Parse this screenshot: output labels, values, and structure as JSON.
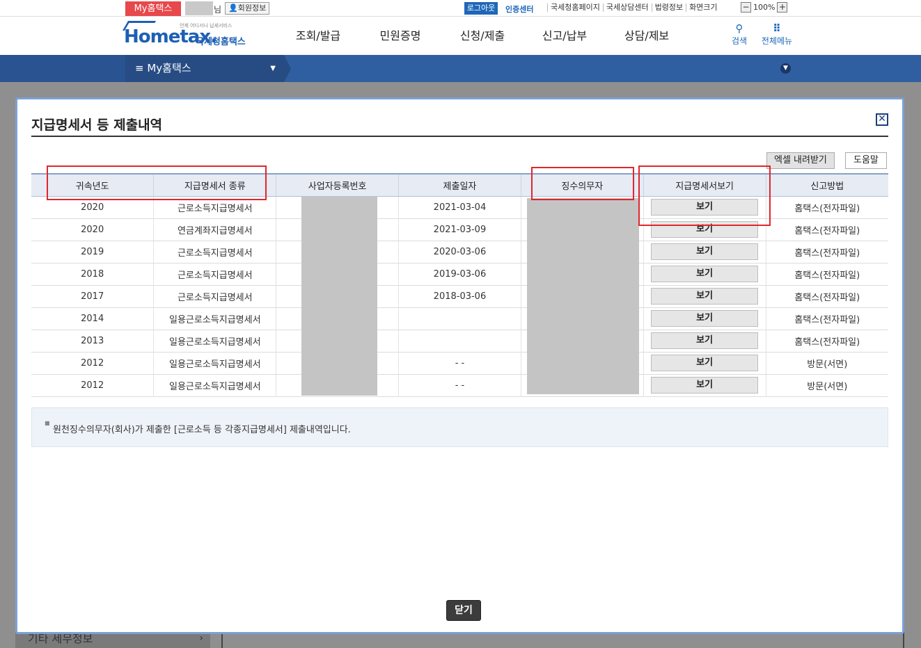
{
  "util": {
    "my_hometax": "My홈택스",
    "user_suffix": "님",
    "member_info": "회원정보",
    "logout": "로그아웃",
    "cert_center": "인증센터",
    "links": [
      "국세청홈페이지",
      "국세상담센터",
      "법령정보",
      "화면크기"
    ],
    "zoom_minus": "−",
    "zoom_value": "100%",
    "zoom_plus": "+"
  },
  "header": {
    "logo_tiny": "언제 어디서나 납세서비스",
    "logo_text": "Hometax.",
    "logo_subtitle": "국세청홈택스",
    "nav": [
      "조회/발급",
      "민원증명",
      "신청/제출",
      "신고/납부",
      "상담/제보"
    ],
    "search_label": "검색",
    "allmenu_label": "전체메뉴"
  },
  "crumb": {
    "menu_icon": "≡",
    "label": "My홈택스"
  },
  "background": {
    "sidebar_item": "기타 세무정보"
  },
  "modal": {
    "title": "지급명세서 등 제출내역",
    "excel_button": "엑셀 내려받기",
    "help_button": "도움말",
    "columns": [
      "귀속년도",
      "지급명세서 종류",
      "사업자등록번호",
      "제출일자",
      "징수의무자",
      "지급명세서보기",
      "신고방법"
    ],
    "view_label": "보기",
    "rows": [
      {
        "year": "2020",
        "type": "근로소득지급명세서",
        "biz_no": "",
        "date": "2021-03-04",
        "payer": "",
        "method": "홈택스(전자파일)"
      },
      {
        "year": "2020",
        "type": "연금계좌지급명세서",
        "biz_no": "",
        "date": "2021-03-09",
        "payer": "",
        "method": "홈택스(전자파일)"
      },
      {
        "year": "2019",
        "type": "근로소득지급명세서",
        "biz_no": "",
        "date": "2020-03-06",
        "payer": "",
        "method": "홈택스(전자파일)"
      },
      {
        "year": "2018",
        "type": "근로소득지급명세서",
        "biz_no": "",
        "date": "2019-03-06",
        "payer": "",
        "method": "홈택스(전자파일)"
      },
      {
        "year": "2017",
        "type": "근로소득지급명세서",
        "biz_no": "",
        "date": "2018-03-06",
        "payer": "",
        "method": "홈택스(전자파일)"
      },
      {
        "year": "2014",
        "type": "일용근로소득지급명세서",
        "biz_no": "",
        "date": "",
        "payer": "",
        "method": "홈택스(전자파일)"
      },
      {
        "year": "2013",
        "type": "일용근로소득지급명세서",
        "biz_no": "",
        "date": "",
        "payer": "",
        "method": "홈택스(전자파일)"
      },
      {
        "year": "2012",
        "type": "일용근로소득지급명세서",
        "biz_no": "",
        "date": "- -",
        "payer": "",
        "method": "방문(서면)"
      },
      {
        "year": "2012",
        "type": "일용근로소득지급명세서",
        "biz_no": "",
        "date": "- -",
        "payer": "",
        "method": "방문(서면)"
      }
    ],
    "note": "원천징수의무자(회사)가 제출한 [근로소득 등 각종지급명세서] 제출내역입니다.",
    "close_button": "닫기"
  }
}
